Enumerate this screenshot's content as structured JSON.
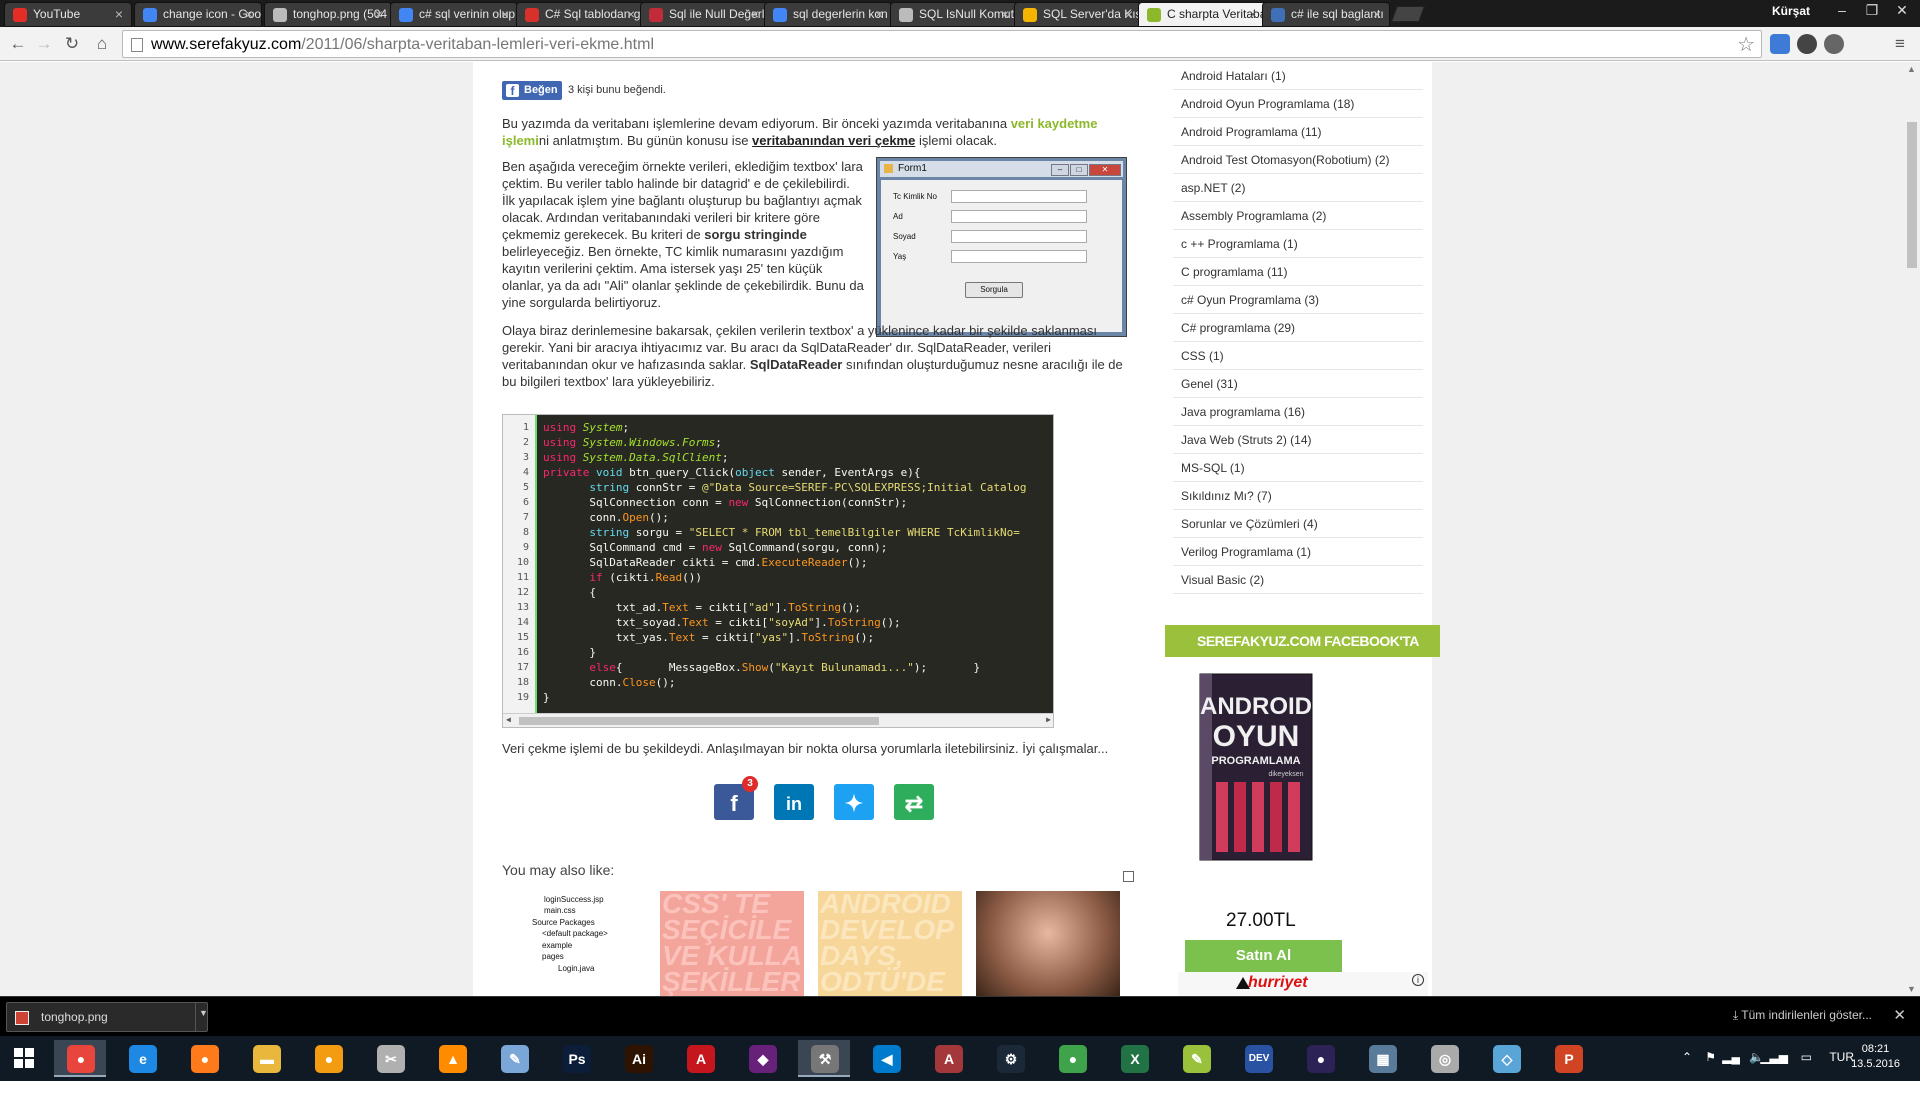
{
  "browser": {
    "tabs": [
      {
        "label": "YouTube",
        "color": "#e52d27"
      },
      {
        "label": "change icon - Goo",
        "color": "#4285f4"
      },
      {
        "label": "tonghop.png (504",
        "color": "#bbbbbb"
      },
      {
        "label": "c# sql verinin olup",
        "color": "#4285f4"
      },
      {
        "label": "C# Sql tablodan g",
        "color": "#d8302a"
      },
      {
        "label": "Sql ile Null Değerl",
        "color": "#c22b39"
      },
      {
        "label": "sql degerlerin kon",
        "color": "#4285f4"
      },
      {
        "label": "SQL IsNull Komutu",
        "color": "#bbbbbb"
      },
      {
        "label": "SQL Server'da Kısı",
        "color": "#f4b400"
      },
      {
        "label": "C sharpta Veritaba",
        "color": "#8cb82b"
      },
      {
        "label": "c# ile sql baglantı",
        "color": "#3f6fb6"
      }
    ],
    "profile_name": "Kürşat",
    "url_domain": "www.serefakyuz.com",
    "url_path": "/2011/06/sharpta-veritaban-lemleri-veri-ekme.html"
  },
  "article": {
    "like_label": "Beğen",
    "like_count": "3 kişi bunu beğendi.",
    "intro": {
      "t1": "Bu yazımda da veritabanı işlemlerine devam ediyorum. Bir önceki yazımda veritabanına ",
      "link1": "veri kaydetme işlemi",
      "t2": "ni anlatmıştım. Bu günün konusu ise ",
      "link2": "veritabanından veri çekme",
      "t3": " işlemi olacak."
    },
    "para2": {
      "t1": "Ben aşağıda vereceğim örnekte verileri, eklediğim textbox' lara çektim. Bu veriler tablo halinde bir datagrid' e de çekilebilirdi. İlk yapılacak işlem yine bağlantı oluşturup bu bağlantıyı açmak olacak. Ardından veritabanındaki verileri bir kritere göre çekmemiz gerekecek. Bu kriteri de ",
      "bold": "sorgu stringinde",
      "t2": " belirleyeceğiz. Ben örnekte, TC kimlik numarasını yazdığım kayıtın verilerini çektim. Ama istersek yaşı 25' ten küçük olanlar, ya da adı \"Ali\" olanlar şeklinde de çekebilirdik. Bunu da yine sorgularda belirtiyoruz."
    },
    "para3": {
      "t1": "Olaya biraz derinlemesine bakarsak, çekilen verilerin textbox' a yüklenince kadar bir şekilde saklanması gerekir. Yani bir aracıya ihtiyacımız var. Bu aracı da SqlDataReader' dır. SqlDataReader, verileri veritabanından okur ve hafızasında saklar. ",
      "bold": "SqlDataReader",
      "t2": " sınıfından oluşturduğumuz nesne aracılığı ile de bu bilgileri textbox' lara yükleyebiliriz."
    },
    "outro": "Veri çekme işlemi de bu şekildeydi. Anlaşılmayan bir nokta olursa yorumlarla iletebilirsiniz. İyi çalışmalar...",
    "share_badge": "3",
    "you_may_also_like": "You may also like:"
  },
  "form1": {
    "title": "Form1",
    "labels": [
      "Tc Kimlik No",
      "Ad",
      "Soyad",
      "Yaş"
    ],
    "button": "Sorgula"
  },
  "code": {
    "line_numbers": [
      "1",
      "2",
      "3",
      "4",
      "5",
      "6",
      "7",
      "8",
      "9",
      "10",
      "11",
      "12",
      "13",
      "14",
      "15",
      "16",
      "17",
      "18",
      "19"
    ]
  },
  "thumbs": {
    "tree": [
      "loginSuccess.jsp",
      "main.css",
      "Source Packages",
      "<default package>",
      "example",
      "pages",
      "Login.java"
    ],
    "css_text": [
      "CSS' TE",
      "SEÇİCİLE",
      "VE KULLA",
      "ŞEKİLLER"
    ],
    "android_text": [
      "ANDROID",
      "DEVELOP",
      "DAYS,",
      "ODTÜ'DE"
    ]
  },
  "sidebar": {
    "categories": [
      "Android Hataları (1)",
      "Android Oyun Programlama (18)",
      "Android Programlama (11)",
      "Android Test Otomasyon(Robotium) (2)",
      "asp.NET (2)",
      "Assembly Programlama (2)",
      "c ++ Programlama (1)",
      "C programlama (11)",
      "c# Oyun Programlama (3)",
      "C# programlama (29)",
      "CSS (1)",
      "Genel (31)",
      "Java programlama (16)",
      "Java Web (Struts 2) (14)",
      "MS-SQL (1)",
      "Sıkıldınız Mı? (7)",
      "Sorunlar ve Çözümleri (4)",
      "Verilog Programlama (1)",
      "Visual Basic (2)"
    ],
    "facebook_header": "SEREFAKYUZ.COM FACEBOOK'TA",
    "book_lines": [
      "ANDROID",
      "OYUN",
      "PROGRAMLAMA"
    ],
    "book_author": "dikeyeksen",
    "price": "27.00TL",
    "buy_label": "Satın Al",
    "shop_logo": "hurriyet"
  },
  "downloads": {
    "file": "tonghop.png",
    "show_all": "Tüm indirilenleri göster..."
  },
  "taskbar": {
    "apps": [
      {
        "name": "chrome",
        "glyph": "●",
        "color": "#e8453c"
      },
      {
        "name": "internet-explorer",
        "glyph": "e",
        "color": "#1e88e5"
      },
      {
        "name": "firefox",
        "glyph": "●",
        "color": "#ff7a1a"
      },
      {
        "name": "file-explorer",
        "glyph": "▬",
        "color": "#e8b73c"
      },
      {
        "name": "media-player",
        "glyph": "●",
        "color": "#f39c12"
      },
      {
        "name": "snipping-tool",
        "glyph": "✂",
        "color": "#b0b0b0"
      },
      {
        "name": "vlc",
        "glyph": "▲",
        "color": "#ff8c00"
      },
      {
        "name": "paint",
        "glyph": "✎",
        "color": "#7aa7d8"
      },
      {
        "name": "photoshop",
        "glyph": "Ps",
        "color": "#0b1d38"
      },
      {
        "name": "illustrator",
        "glyph": "Ai",
        "color": "#2d1300"
      },
      {
        "name": "acrobat",
        "glyph": "A",
        "color": "#c4161c"
      },
      {
        "name": "visual-studio",
        "glyph": "◆",
        "color": "#68217a"
      },
      {
        "name": "tools",
        "glyph": "⚒",
        "color": "#777777"
      },
      {
        "name": "vs-code",
        "glyph": "◀",
        "color": "#007acc"
      },
      {
        "name": "access",
        "glyph": "A",
        "color": "#a4373a"
      },
      {
        "name": "steam",
        "glyph": "⚙",
        "color": "#1b2838"
      },
      {
        "name": "network-app",
        "glyph": "●",
        "color": "#3ea34a"
      },
      {
        "name": "excel",
        "glyph": "X",
        "color": "#217346"
      },
      {
        "name": "notepad-plus",
        "glyph": "✎",
        "color": "#9ac13c"
      },
      {
        "name": "dev-cpp",
        "glyph": "DEV",
        "color": "#2952a3"
      },
      {
        "name": "eclipse",
        "glyph": "●",
        "color": "#2c2255"
      },
      {
        "name": "calculator",
        "glyph": "▦",
        "color": "#5a7a9a"
      },
      {
        "name": "disc-burner",
        "glyph": "◎",
        "color": "#aaaaaa"
      },
      {
        "name": "virtualbox",
        "glyph": "◇",
        "color": "#5aa5d8"
      },
      {
        "name": "powerpoint",
        "glyph": "P",
        "color": "#d04423"
      }
    ],
    "lang": "TUR",
    "time": "08:21",
    "date": "13.5.2016"
  }
}
